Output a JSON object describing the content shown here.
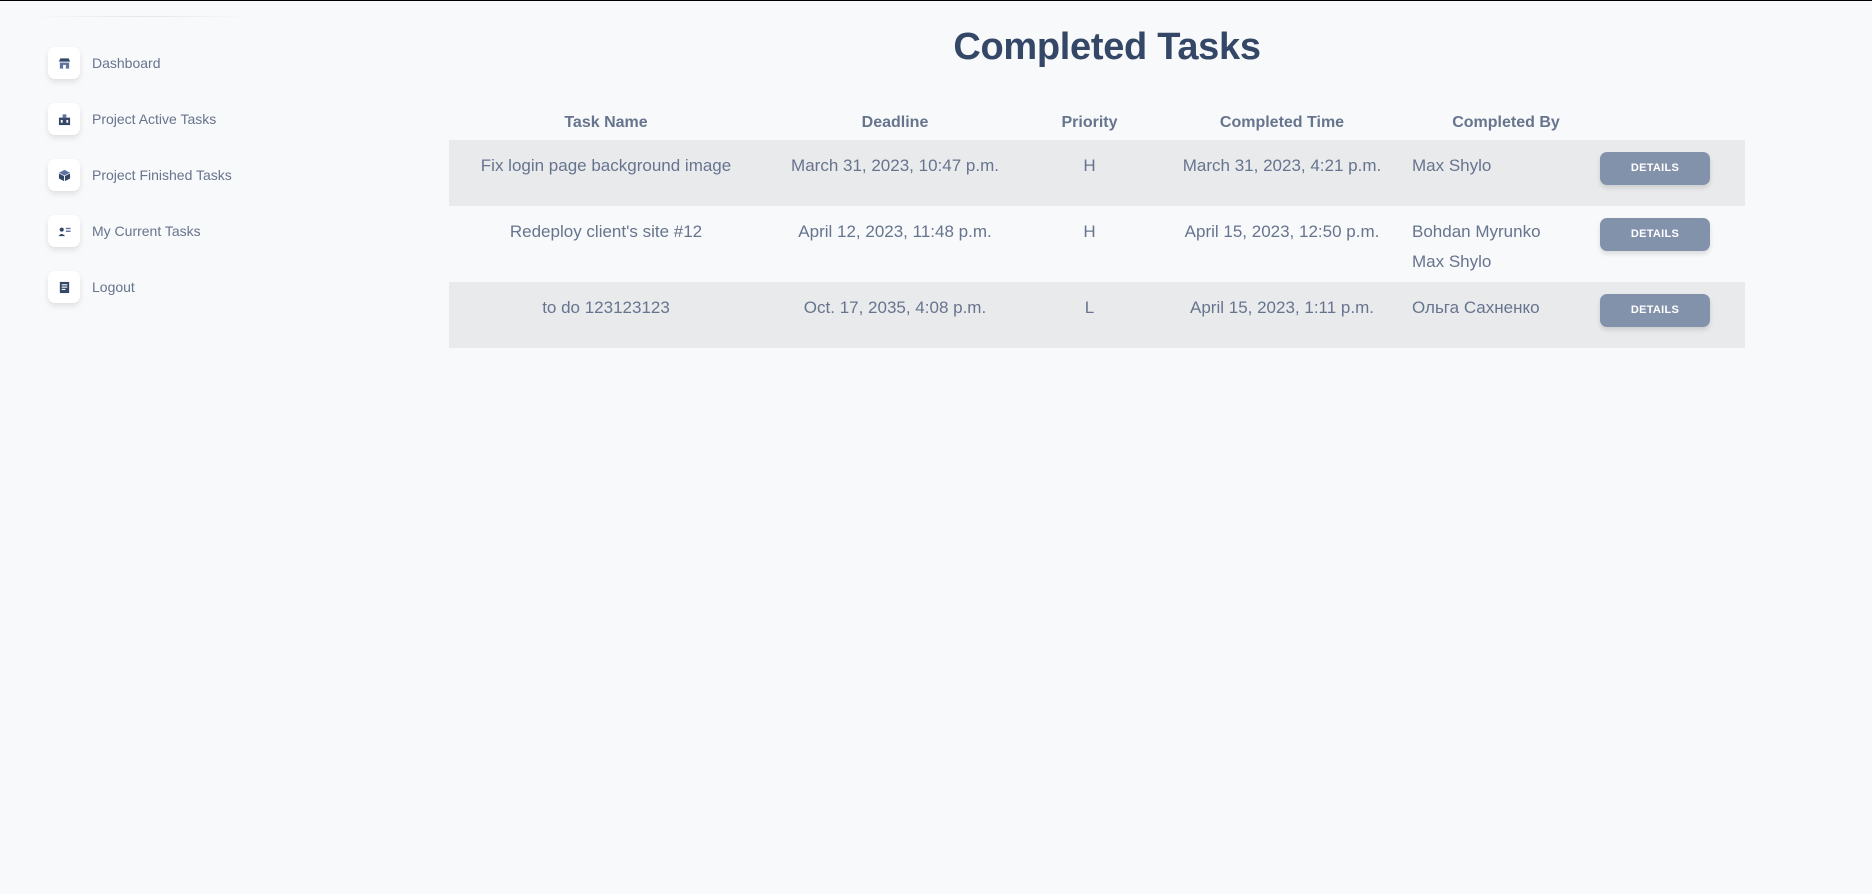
{
  "sidebar": {
    "items": [
      {
        "label": "Dashboard",
        "icon": "shop-icon"
      },
      {
        "label": "Project Active Tasks",
        "icon": "office-icon"
      },
      {
        "label": "Project Finished Tasks",
        "icon": "box-icon"
      },
      {
        "label": "My Current Tasks",
        "icon": "user-tasks-icon"
      },
      {
        "label": "Logout",
        "icon": "document-icon"
      }
    ]
  },
  "main": {
    "title": "Completed Tasks",
    "columns": [
      "Task Name",
      "Deadline",
      "Priority",
      "Completed Time",
      "Completed By"
    ],
    "rows": [
      {
        "task_name": "Fix login page background image",
        "deadline": "March 31, 2023, 10:47 p.m.",
        "priority": "H",
        "completed_time": "March 31, 2023, 4:21 p.m.",
        "completed_by": [
          "Max Shylo"
        ],
        "action": "DETAILS"
      },
      {
        "task_name": "Redeploy client's site #12",
        "deadline": "April 12, 2023, 11:48 p.m.",
        "priority": "H",
        "completed_time": "April 15, 2023, 12:50 p.m.",
        "completed_by": [
          "Bohdan Myrunko",
          "Max Shylo"
        ],
        "action": "DETAILS"
      },
      {
        "task_name": "to do 123123123",
        "deadline": "Oct. 17, 2035, 4:08 p.m.",
        "priority": "L",
        "completed_time": "April 15, 2023, 1:11 p.m.",
        "completed_by": [
          "Ольга Сахненко"
        ],
        "action": "DETAILS"
      }
    ]
  },
  "colors": {
    "background": "#f8f9fa",
    "title": "#344767",
    "text": "#67748e",
    "stripe": "#e9eaec",
    "button": "#8392ab"
  }
}
